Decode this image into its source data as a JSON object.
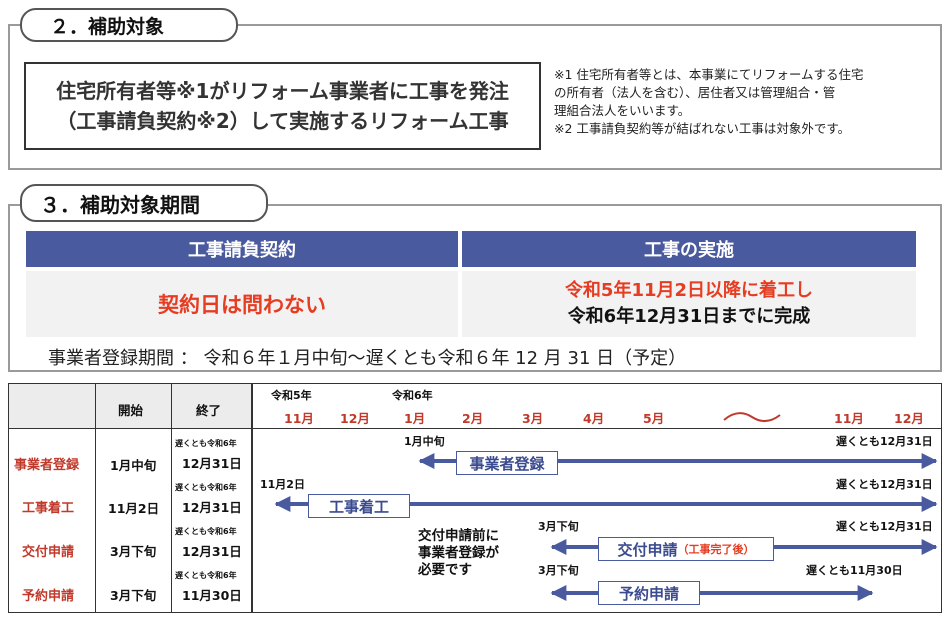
{
  "section2": {
    "title": "２．補助対象",
    "target_line1": "住宅所有者等※1がリフォーム事業者に工事を発注",
    "target_line2": "（工事請負契約※2）して実施するリフォーム工事",
    "note1_line1": "※1 住宅所有者等とは、本事業にてリフォームする住宅",
    "note1_line2": "の所有者（法人を含む）、居住者又は管理組合・管",
    "note1_line3": "理組合法人をいいます。",
    "note2": "※2 工事請負契約等が結ばれない工事は対象外です。"
  },
  "section3": {
    "title": "３．補助対象期間",
    "col1_header": "工事請負契約",
    "col2_header": "工事の実施",
    "col1_value": "契約日は問わない",
    "col2_value_line1": "令和5年11月2日以降に着工し",
    "col2_value_line2": "令和6年12月31日までに完成",
    "registration_period": "事業者登録期間 ： 令和６年１月中旬～遅くとも令和６年 12 月 31 日（予定）"
  },
  "timeline": {
    "headers": {
      "start": "開始",
      "end": "終了"
    },
    "years": {
      "r5": "令和5年",
      "r6": "令和6年"
    },
    "months": [
      "11月",
      "12月",
      "1月",
      "2月",
      "3月",
      "4月",
      "5月",
      "11月",
      "12月"
    ],
    "rows": [
      {
        "label": "事業者登録",
        "start": "1月中旬",
        "end_prefix": "遅くとも令和6年",
        "end": "12月31日",
        "left_text": "1月中旬",
        "right_text": "遅くとも12月31日",
        "bar_label": "事業者登録"
      },
      {
        "label": "工事着工",
        "start": "11月2日",
        "end_prefix": "遅くとも令和6年",
        "end": "12月31日",
        "left_text": "11月2日",
        "right_text": "遅くとも12月31日",
        "bar_label": "工事着工"
      },
      {
        "label": "交付申請",
        "start": "3月下旬",
        "end_prefix": "遅くとも令和6年",
        "end": "12月31日",
        "left_text": "3月下旬",
        "right_text": "遅くとも12月31日",
        "bar_label": "交付申請",
        "bar_sub": "（工事完了後）"
      },
      {
        "label": "予約申請",
        "start": "3月下旬",
        "end_prefix": "遅くとも令和6年",
        "end": "11月30日",
        "left_text": "3月下旬",
        "right_text": "遅くとも11月30日",
        "bar_label": "予約申請"
      }
    ],
    "note_line1": "交付申請前に",
    "note_line2": "事業者登録が",
    "note_line3": "必要です"
  },
  "colors": {
    "navy": "#4a5a9e",
    "red": "#e63c21",
    "row_red": "#c0392b"
  }
}
